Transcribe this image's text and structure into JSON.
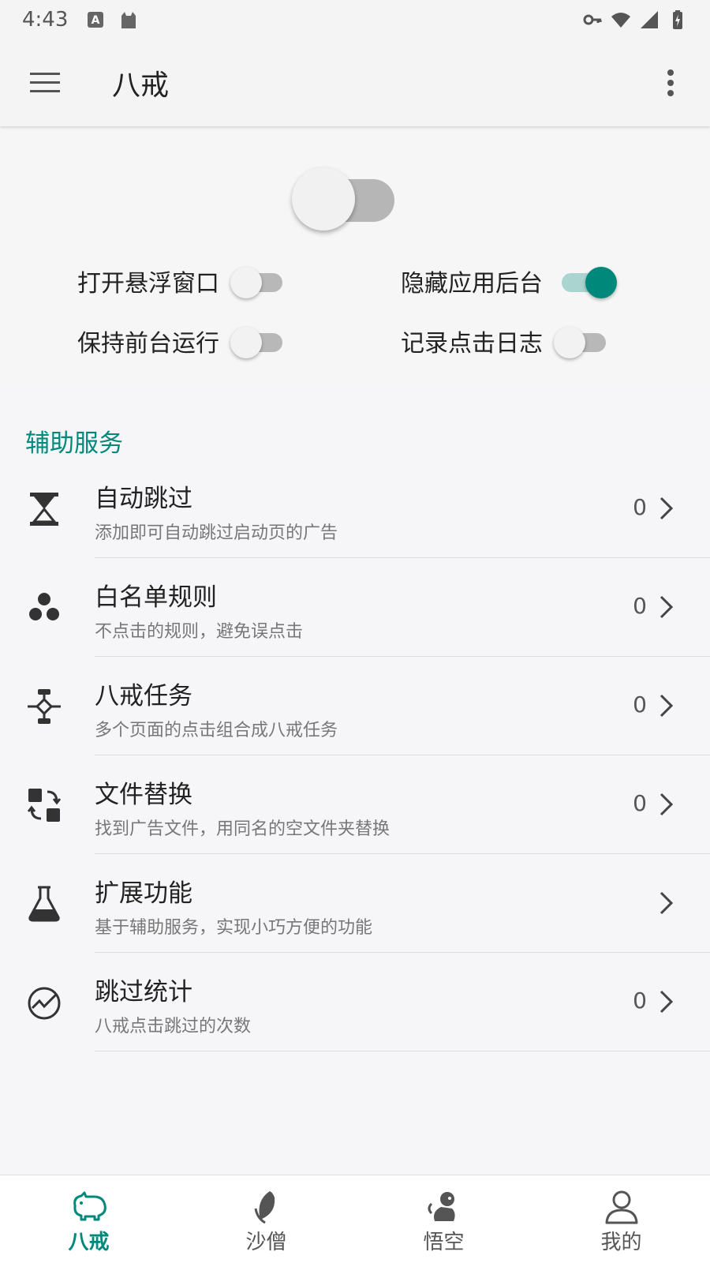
{
  "status_bar": {
    "time": "4:43"
  },
  "app_bar": {
    "title": "八戒"
  },
  "options": {
    "floating_window": {
      "label": "打开悬浮窗口",
      "on": false
    },
    "hide_background": {
      "label": "隐藏应用后台",
      "on": true
    },
    "keep_foreground": {
      "label": "保持前台运行",
      "on": false
    },
    "click_log": {
      "label": "记录点击日志",
      "on": false
    }
  },
  "section_title": "辅助服务",
  "items": [
    {
      "icon": "hourglass-icon",
      "title": "自动跳过",
      "subtitle": "添加即可自动跳过启动页的广告",
      "count": "0"
    },
    {
      "icon": "group-dots-icon",
      "title": "白名单规则",
      "subtitle": "不点击的规则，避免误点击",
      "count": "0"
    },
    {
      "icon": "workflow-icon",
      "title": "八戒任务",
      "subtitle": "多个页面的点击组合成八戒任务",
      "count": "0"
    },
    {
      "icon": "swap-files-icon",
      "title": "文件替换",
      "subtitle": "找到广告文件，用同名的空文件夹替换",
      "count": "0"
    },
    {
      "icon": "flask-icon",
      "title": "扩展功能",
      "subtitle": "基于辅助服务，实现小巧方便的功能",
      "count": ""
    },
    {
      "icon": "stats-icon",
      "title": "跳过统计",
      "subtitle": "八戒点击跳过的次数",
      "count": "0"
    }
  ],
  "bottom_nav": [
    {
      "label": "八戒",
      "icon": "pig-icon",
      "active": true
    },
    {
      "label": "沙僧",
      "icon": "leaf-icon",
      "active": false
    },
    {
      "label": "悟空",
      "icon": "monkey-icon",
      "active": false
    },
    {
      "label": "我的",
      "icon": "person-icon",
      "active": false
    }
  ],
  "colors": {
    "accent": "#00897b",
    "accent_light": "#a9d4cf"
  }
}
